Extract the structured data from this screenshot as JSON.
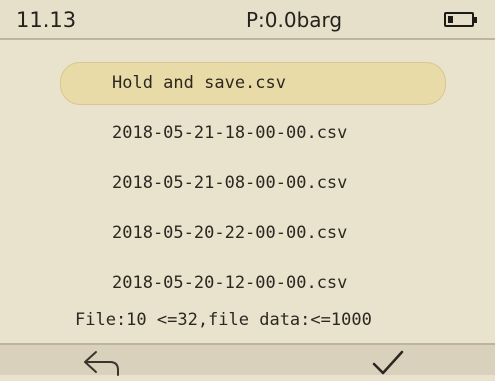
{
  "status_bar": {
    "time": "11.13",
    "pressure": "P:0.0barg",
    "battery_icon": "battery-low-icon"
  },
  "file_list": {
    "items": [
      {
        "label": "Hold and save.csv",
        "selected": true
      },
      {
        "label": "2018-05-21-18-00-00.csv",
        "selected": false
      },
      {
        "label": "2018-05-21-08-00-00.csv",
        "selected": false
      },
      {
        "label": "2018-05-20-22-00-00.csv",
        "selected": false
      },
      {
        "label": "2018-05-20-12-00-00.csv",
        "selected": false
      }
    ]
  },
  "summary": {
    "text": "File:10 <=32,file data:<=1000"
  },
  "bottom_bar": {
    "back_icon": "back-arrow-icon",
    "confirm_icon": "checkmark-icon"
  },
  "colors": {
    "background": "#e9e2cd",
    "selected_highlight": "#e9dba8",
    "text": "#2a2620"
  }
}
